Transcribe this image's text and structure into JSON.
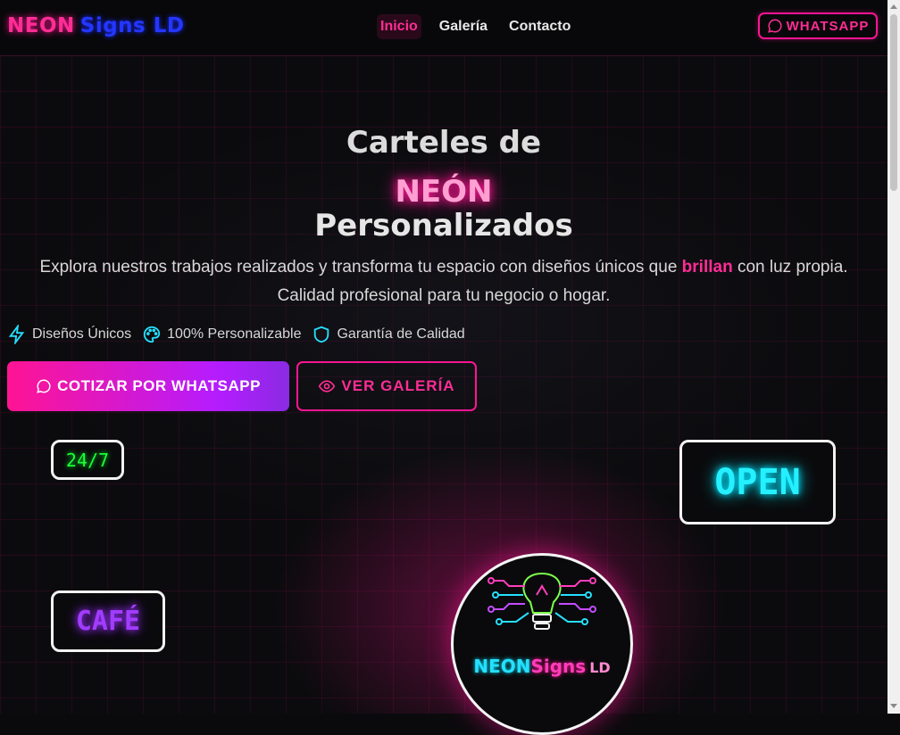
{
  "header": {
    "logo_part1": "NEON",
    "logo_part2": "Signs LD",
    "nav": [
      {
        "label": "Inicio",
        "active": true
      },
      {
        "label": "Galería",
        "active": false
      },
      {
        "label": "Contacto",
        "active": false
      }
    ],
    "whatsapp_label": "WHATSAPP",
    "whatsapp_icon": "chat-bubble-icon"
  },
  "hero": {
    "title_line1": "Carteles de",
    "title_line2": "NEÓN",
    "title_line3": "Personalizados",
    "subtitle_before": "Explora nuestros trabajos realizados y transforma tu espacio con diseños únicos que ",
    "subtitle_highlight": "brillan",
    "subtitle_after": " con luz propia. Calidad profesional para tu negocio o hogar.",
    "features": [
      {
        "icon": "lightning-icon",
        "label": "Diseños Únicos"
      },
      {
        "icon": "palette-icon",
        "label": "100% Personalizable"
      },
      {
        "icon": "shield-icon",
        "label": "Garantía de Calidad"
      }
    ],
    "cta_primary": "COTIZAR POR WHATSAPP",
    "cta_secondary": "VER GALERÍA"
  },
  "signs": {
    "sign_247": "24/7",
    "sign_open": "OPEN",
    "sign_cafe": "CAFÉ"
  },
  "circle_logo": {
    "part1": "NEON",
    "part2": "Signs",
    "part3": "LD"
  },
  "colors": {
    "accent_pink": "#ff1493",
    "accent_blue": "#2436ff",
    "neon_green": "#1aff3a",
    "neon_cyan": "#25f0ff",
    "neon_purple": "#a23cff"
  }
}
